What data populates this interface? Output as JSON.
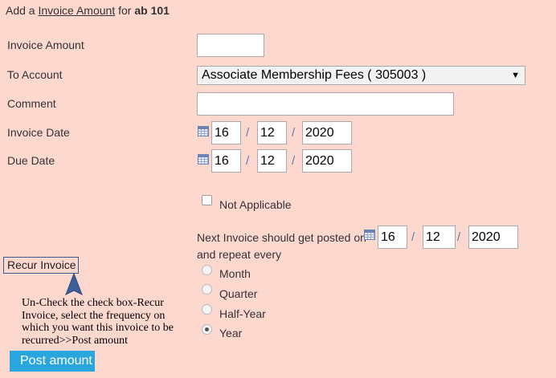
{
  "header": {
    "prefix": "Add a",
    "link": "Invoice Amount",
    "middle": "for",
    "account": "ab 101"
  },
  "form": {
    "invoice_amount_label": "Invoice Amount",
    "invoice_amount_value": "",
    "to_account_label": "To Account",
    "to_account_selected": "Associate Membership Fees ( 305003 )",
    "comment_label": "Comment",
    "comment_value": "",
    "invoice_date_label": "Invoice Date",
    "invoice_date": {
      "day": "16",
      "month": "12",
      "year": "2020"
    },
    "due_date_label": "Due Date",
    "due_date": {
      "day": "16",
      "month": "12",
      "year": "2020"
    },
    "date_separator": "/",
    "not_applicable_label": "Not Applicable",
    "not_applicable_checked": false
  },
  "recur": {
    "next_invoice_label": "Next Invoice should get posted on",
    "next_date": {
      "day": "16",
      "month": "12",
      "year": "2020"
    },
    "repeat_label": "and repeat every",
    "options": [
      "Month",
      "Quarter",
      "Half-Year",
      "Year"
    ],
    "selected": "Year",
    "recur_invoice_label": "Recur Invoice"
  },
  "annotation": {
    "text": "Un-Check the check box-Recur Invoice, select the frequency on which you want this invoice to be recurred>>Post amount"
  },
  "post_button_label": "Post amount",
  "colors": {
    "background": "#fdd8cf",
    "button": "#29a6de",
    "arrow": "#3b5f9a"
  }
}
